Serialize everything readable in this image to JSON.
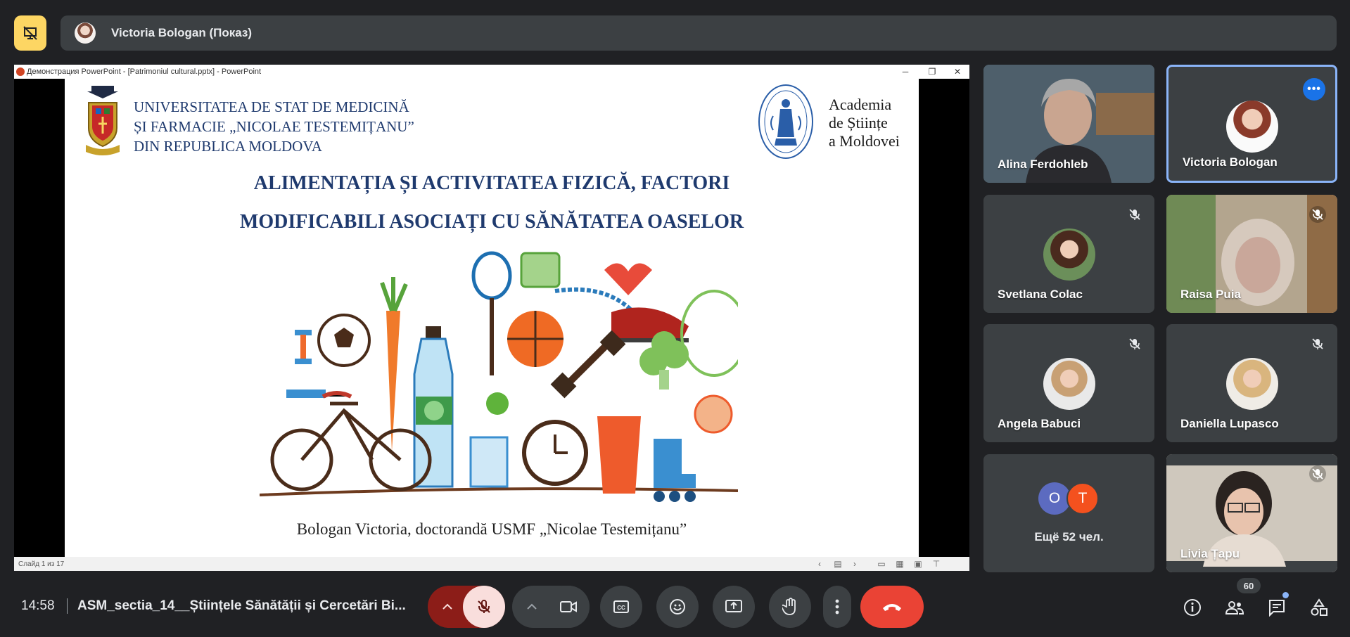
{
  "presenter_bar": {
    "label": "Victoria Bologan (Показ)"
  },
  "ppt": {
    "window_title": "Демонстрация PowerPoint - [Patrimoniul cultural.pptx] - PowerPoint",
    "status_text": "Слайд 1 из 17"
  },
  "slide": {
    "usmf_lines": [
      "UNIVERSITATEA DE STAT DE MEDICINĂ",
      "ȘI FARMACIE „NICOLAE TESTEMIȚANU”",
      "DIN REPUBLICA MOLDOVA"
    ],
    "asm_lines": [
      "Academia",
      "de Științe",
      "a Moldovei"
    ],
    "asm_seal_text": "ACADEMIA DE ȘTIINȚE A MOLDOVEI",
    "title_line1": "ALIMENTAȚIA ȘI ACTIVITATEA FIZICĂ, FACTORI",
    "title_line2": "MODIFICABILI ASOCIAȚI CU SĂNĂTATEA OASELOR",
    "author": "Bologan Victoria, doctorandă USMF „Nicolae Testemițanu”"
  },
  "participants": [
    {
      "name": "Alina Ferdohleb",
      "muted": false
    },
    {
      "name": "Victoria Bologan",
      "muted": false
    },
    {
      "name": "Svetlana Colac",
      "muted": true
    },
    {
      "name": "Raisa Puia",
      "muted": true
    },
    {
      "name": "Angela Babuci",
      "muted": true
    },
    {
      "name": "Daniella Lupasco",
      "muted": true
    },
    {
      "name": "Liviа Țapu",
      "muted": true
    }
  ],
  "others": {
    "label": "Ещё 52 чел.",
    "initials": [
      "O",
      "T"
    ],
    "colors": [
      "#5c6bc0",
      "#f4511e"
    ]
  },
  "bottom": {
    "time": "14:58",
    "meeting_name": "ASM_sectia_14__Științele Sănătății și Cercetări Bi...",
    "participant_count": "60"
  },
  "colors": {
    "accent": "#1a73e8",
    "end_call": "#ea4335",
    "mic_off_bg": "#f9dedc",
    "present_icon": "#fdd663"
  }
}
